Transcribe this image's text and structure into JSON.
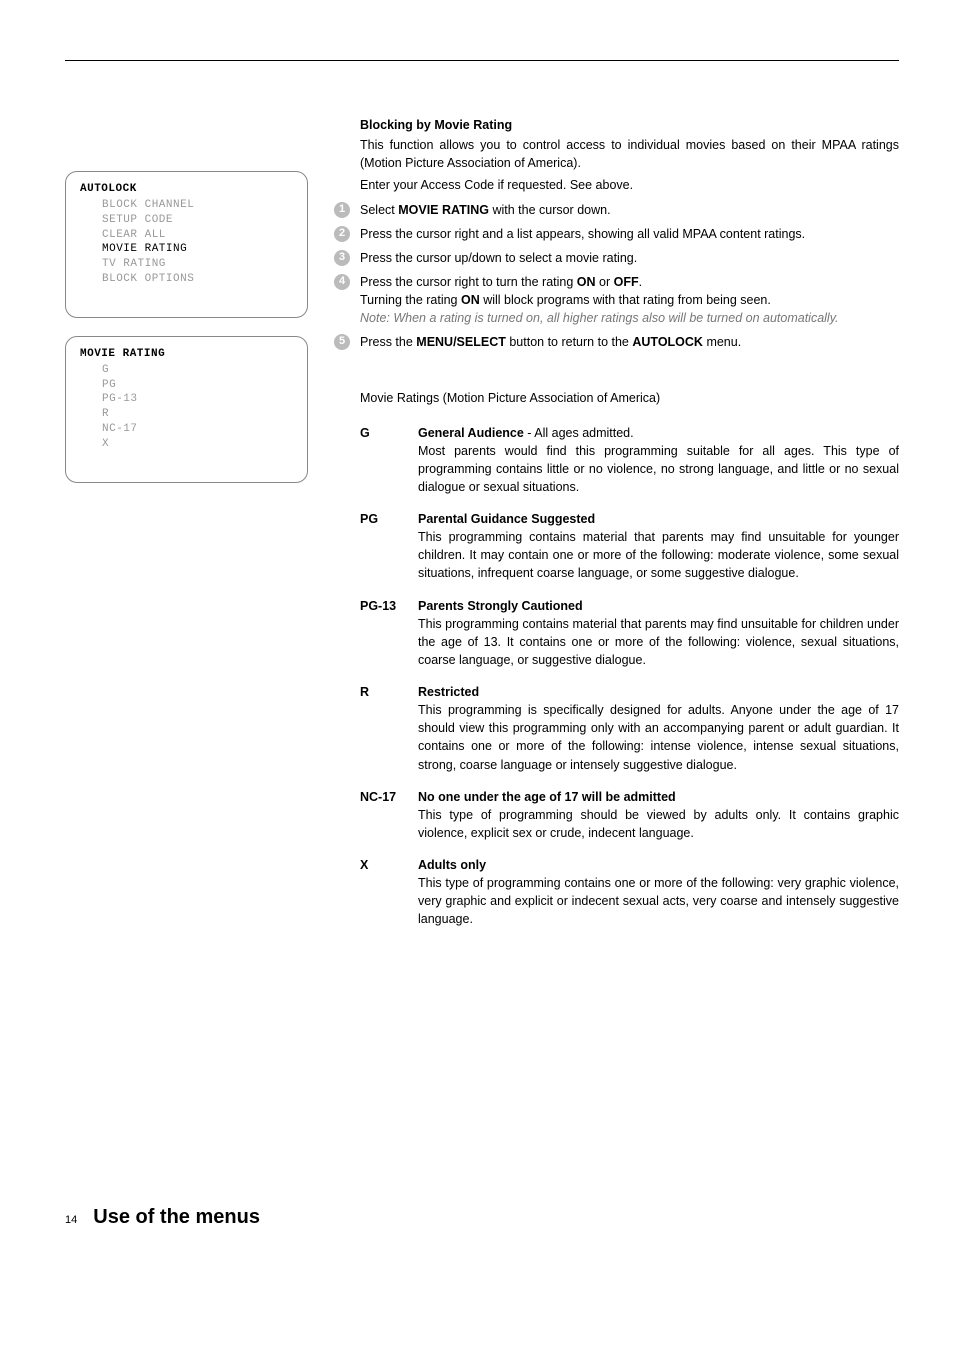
{
  "menus": {
    "autolock": {
      "title": "AUTOLOCK",
      "items": [
        "BLOCK CHANNEL",
        "SETUP CODE",
        "CLEAR ALL",
        "MOVIE RATING",
        "TV RATING",
        "BLOCK OPTIONS"
      ],
      "active_index": 3
    },
    "movie_rating": {
      "title": "MOVIE RATING",
      "items": [
        "G",
        "PG",
        "PG-13",
        "R",
        "NC-17",
        "X"
      ],
      "active_index": -1
    }
  },
  "section": {
    "title": "Blocking by Movie Rating",
    "intro1": "This function allows you to control access to individual movies based on their MPAA ratings (Motion Picture Association of America).",
    "intro2": "Enter your Access Code if requested. See above."
  },
  "steps": [
    {
      "n": "1",
      "pre": "Select ",
      "b1": "MOVIE RATING",
      "post": " with the cursor down."
    },
    {
      "n": "2",
      "text": "Press the cursor right and a list appears, showing all valid MPAA content ratings."
    },
    {
      "n": "3",
      "text": "Press the cursor up/down to select a movie rating."
    },
    {
      "n": "4",
      "line1_pre": "Press the cursor right to turn the rating ",
      "line1_b1": "ON",
      "line1_mid": " or ",
      "line1_b2": "OFF",
      "line1_post": ".",
      "line2_pre": "Turning the rating ",
      "line2_b1": "ON",
      "line2_post": " will block programs with that rating from being seen.",
      "note": "Note: When a rating is turned on, all higher ratings also will be turned on automatically."
    },
    {
      "n": "5",
      "pre": "Press the ",
      "b1": "MENU/SELECT",
      "mid": " button to return to the ",
      "b2": "AUTOLOCK",
      "post": " menu."
    }
  ],
  "ratings_heading": "Movie Ratings (Motion Picture Association of America)",
  "ratings": [
    {
      "code": "G",
      "title": "General Audience",
      "title_suffix": " - All ages admitted.",
      "body": "Most parents would find this programming suitable for all ages. This type of programming contains little or no violence, no strong language, and little or no sexual dialogue or sexual situations."
    },
    {
      "code": "PG",
      "title": "Parental Guidance Suggested",
      "title_suffix": "",
      "body": "This programming contains material that parents may find unsuitable for younger children. It may contain one or more of the following: moderate violence, some sexual situations, infrequent coarse language, or some suggestive dialogue."
    },
    {
      "code": "PG-13",
      "title": "Parents Strongly Cautioned",
      "title_suffix": "",
      "body": "This programming contains material that parents may find unsuitable for children under the age of 13. It contains one or more of the following: violence, sexual situations, coarse language, or suggestive dialogue."
    },
    {
      "code": "R",
      "title": "Restricted",
      "title_suffix": "",
      "body": "This programming is specifically designed for adults. Anyone under the age of 17 should view this programming only with an accompanying parent or adult guardian. It contains one or more of the following: intense violence, intense sexual situations, strong, coarse language or intensely suggestive dialogue."
    },
    {
      "code": "NC-17",
      "title": "No one under the age of 17 will be admitted",
      "title_suffix": "",
      "body": "This type of programming should be viewed by adults only. It contains graphic violence, explicit sex or crude, indecent language."
    },
    {
      "code": "X",
      "title": "Adults only",
      "title_suffix": "",
      "body": "This type of programming contains one or more of the following: very graphic violence, very graphic and explicit or indecent sexual acts, very coarse and intensely suggestive language."
    }
  ],
  "footer": {
    "page": "14",
    "title": "Use of the menus"
  }
}
